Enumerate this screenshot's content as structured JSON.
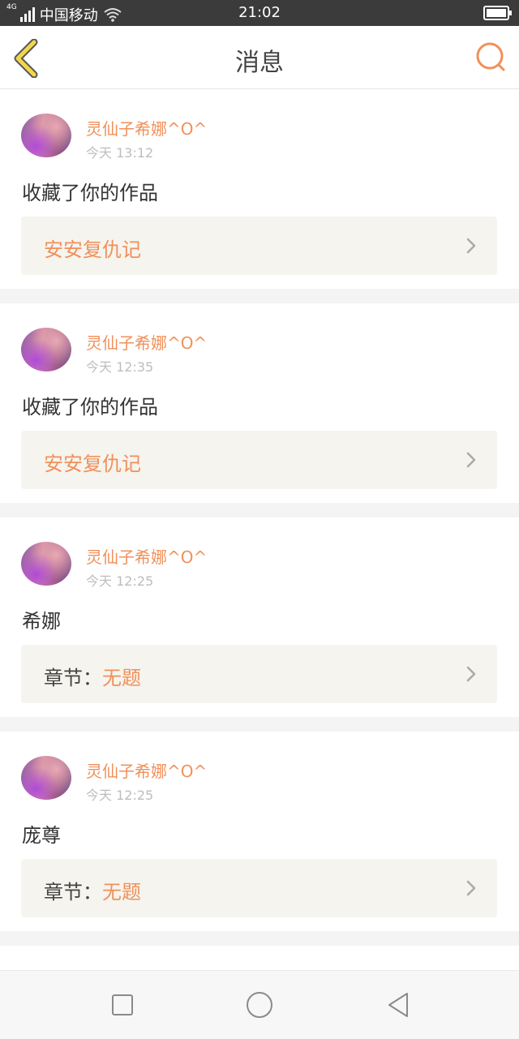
{
  "status_bar": {
    "network": "4G",
    "carrier": "中国移动",
    "time": "21:02"
  },
  "header": {
    "title": "消息",
    "back_icon": "chevron-left-icon",
    "search_icon": "search-icon",
    "accent_color": "#f0905a",
    "back_color": "#f3d74a"
  },
  "messages": [
    {
      "username": "灵仙子希娜^O^",
      "time": "今天 13:12",
      "text": "收藏了你的作品",
      "link_prefix": "",
      "link_name": "安安复仇记"
    },
    {
      "username": "灵仙子希娜^O^",
      "time": "今天 12:35",
      "text": "收藏了你的作品",
      "link_prefix": "",
      "link_name": "安安复仇记"
    },
    {
      "username": "灵仙子希娜^O^",
      "time": "今天 12:25",
      "text": "希娜",
      "link_prefix": "章节：",
      "link_name": "无题"
    },
    {
      "username": "灵仙子希娜^O^",
      "time": "今天 12:25",
      "text": "庞尊",
      "link_prefix": "章节：",
      "link_name": "无题"
    }
  ],
  "nav_bar": {
    "buttons": [
      "recent-apps",
      "home",
      "back"
    ]
  }
}
